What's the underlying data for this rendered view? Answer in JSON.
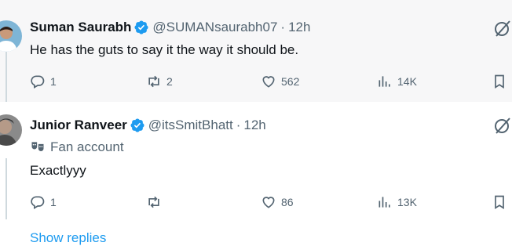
{
  "replies": [
    {
      "name": "Suman Saurabh",
      "handle": "@SUMANsaurabh07",
      "time": "12h",
      "text": "He has the guts to say it the way it should be.",
      "stats": {
        "replies": "1",
        "reposts": "2",
        "likes": "562",
        "views": "14K"
      }
    },
    {
      "name": "Junior Ranveer",
      "handle": "@itsSmitBhatt",
      "time": "12h",
      "badge": "Fan account",
      "text": "Exactlyyy",
      "stats": {
        "replies": "1",
        "reposts": "",
        "likes": "86",
        "views": "13K"
      }
    }
  ],
  "dot": "·",
  "show_replies": "Show replies",
  "colors": {
    "accent": "#1d9bf0",
    "muted": "#536471",
    "highlight_bg": "#f7f7f8"
  }
}
